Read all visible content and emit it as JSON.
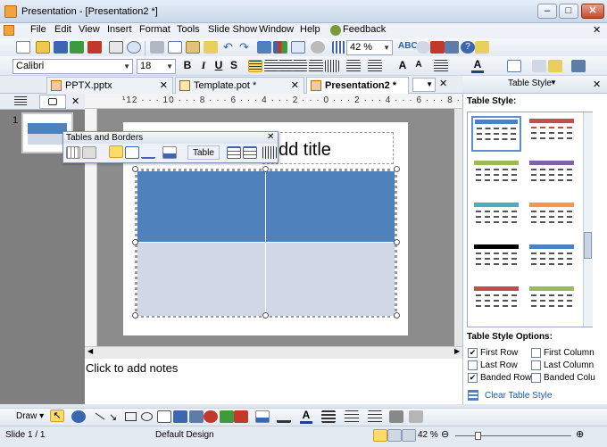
{
  "window": {
    "title": "Presentation - [Presentation2 *]"
  },
  "menu": [
    "File",
    "Edit",
    "View",
    "Insert",
    "Format",
    "Tools",
    "Slide Show",
    "Window",
    "Help",
    "Feedback"
  ],
  "toolbar": {
    "zoom": "42 %",
    "font": "Calibri",
    "size": "18",
    "bold": "B",
    "italic": "I",
    "underline": "U",
    "shadow": "S",
    "grow": "A",
    "shrink": "A"
  },
  "tabs": [
    {
      "label": "PPTX.pptx",
      "active": false
    },
    {
      "label": "Template.pot *",
      "active": false
    },
    {
      "label": "Presentation2 *",
      "active": true
    }
  ],
  "slide_panel": {
    "slide_number": "1"
  },
  "ruler": "¹12 · · · 10 · · · 8 · · · 6 · · · 4 · · · 2 · · · 0 · · · 2 · · · 4 · · · 6 · · · 8 · · · 10 · · · 12¹",
  "slide": {
    "title_placeholder": "dd title"
  },
  "notes": {
    "placeholder": "Click to add notes"
  },
  "floating_toolbar": {
    "title": "Tables and Borders",
    "table_label": "Table"
  },
  "task_pane": {
    "title": "Table Style",
    "section_styles": "Table Style:",
    "section_options": "Table Style Options:",
    "options": [
      {
        "label": "First Row",
        "checked": true
      },
      {
        "label": "First Column",
        "checked": false
      },
      {
        "label": "Last Row",
        "checked": false
      },
      {
        "label": "Last Column",
        "checked": false
      },
      {
        "label": "Banded Rows",
        "checked": true
      },
      {
        "label": "Banded Colu",
        "checked": false
      }
    ],
    "clear_link": "Clear Table Style"
  },
  "drawing_toolbar": {
    "draw_label": "Draw"
  },
  "status": {
    "slide": "Slide 1 / 1",
    "design": "Default Design",
    "zoom": "42 %"
  },
  "colors": {
    "table_header": "#4f81bd",
    "table_band": "#d0d8e8",
    "link": "#1a56b8"
  }
}
